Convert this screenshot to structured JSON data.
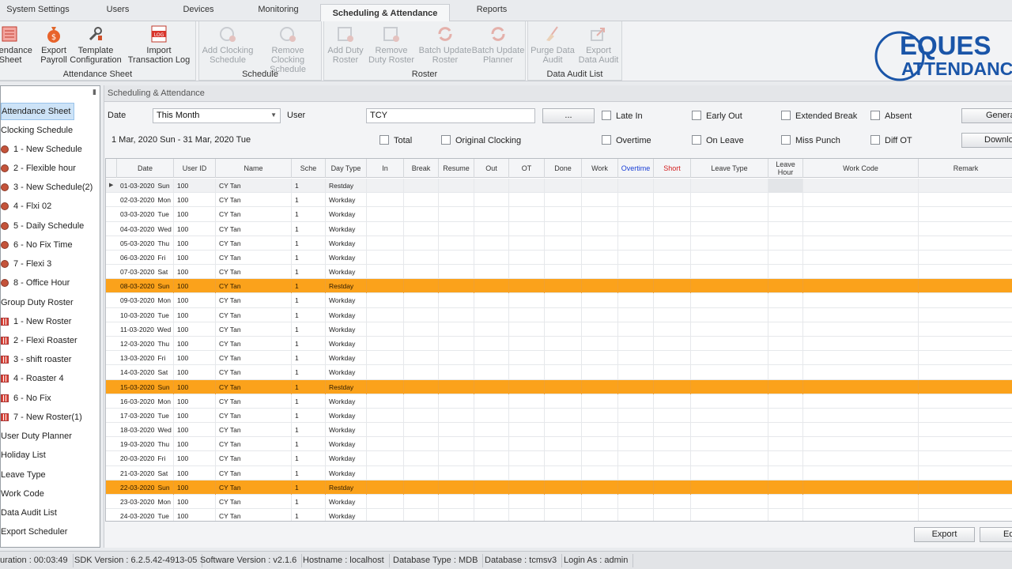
{
  "tabs": [
    {
      "label": "System Settings"
    },
    {
      "label": "Users"
    },
    {
      "label": "Devices"
    },
    {
      "label": "Monitoring"
    },
    {
      "label": "Scheduling & Attendance",
      "active": true
    },
    {
      "label": "Reports"
    }
  ],
  "ribbon": {
    "groups": [
      {
        "label": "Attendance Sheet",
        "buttons": [
          {
            "label": "Attendance Sheet",
            "icon": "sheet-icon",
            "enabled": true
          },
          {
            "label": "Export Payroll",
            "icon": "money-bag-icon",
            "enabled": true
          },
          {
            "label": "Template Configuration",
            "icon": "wrench-icon",
            "enabled": true
          },
          {
            "label": "Import Transaction Log",
            "icon": "log-icon",
            "enabled": true
          }
        ]
      },
      {
        "label": "Schedule",
        "buttons": [
          {
            "label": "Add Clocking Schedule",
            "icon": "add-schedule-icon",
            "enabled": false
          },
          {
            "label": "Remove Clocking Schedule",
            "icon": "remove-schedule-icon",
            "enabled": false
          }
        ]
      },
      {
        "label": "Roster",
        "buttons": [
          {
            "label": "Add Duty Roster",
            "icon": "add-roster-icon",
            "enabled": false
          },
          {
            "label": "Remove Duty Roster",
            "icon": "remove-roster-icon",
            "enabled": false
          },
          {
            "label": "Batch Update Roster",
            "icon": "refresh-icon",
            "enabled": false
          },
          {
            "label": "Batch Update Planner",
            "icon": "refresh-icon",
            "enabled": false
          }
        ]
      },
      {
        "label": "Data Audit List",
        "buttons": [
          {
            "label": "Purge Data Audit",
            "icon": "broom-icon",
            "enabled": false
          },
          {
            "label": "Export Data Audit",
            "icon": "export-icon",
            "enabled": false
          }
        ]
      }
    ]
  },
  "logo": {
    "line1": "EQUES",
    "line2": "ATTENDANC"
  },
  "sidebar": {
    "items": [
      {
        "label": "Attendance Sheet",
        "selected": true,
        "icon": ""
      },
      {
        "label": "Clocking Schedule",
        "icon": ""
      },
      {
        "label": "1 - New Schedule",
        "icon": "clock-icon"
      },
      {
        "label": "2 - Flexible hour",
        "icon": "clock-icon"
      },
      {
        "label": "3 - New Schedule(2)",
        "icon": "clock-icon"
      },
      {
        "label": "4 - Flxi 02",
        "icon": "clock-icon"
      },
      {
        "label": "5 - Daily Schedule",
        "icon": "clock-icon"
      },
      {
        "label": "6 - No Fix Time",
        "icon": "clock-icon"
      },
      {
        "label": "7 - Flexi 3",
        "icon": "clock-icon"
      },
      {
        "label": "8 - Office Hour",
        "icon": "clock-icon"
      },
      {
        "label": "Group Duty Roster",
        "icon": ""
      },
      {
        "label": "1 - New Roster",
        "icon": "calendar-icon"
      },
      {
        "label": "2 - Flexi Roaster",
        "icon": "calendar-icon"
      },
      {
        "label": "3 - shift roaster",
        "icon": "calendar-icon"
      },
      {
        "label": "4 - Roaster 4",
        "icon": "calendar-icon"
      },
      {
        "label": "6 - No Fix",
        "icon": "calendar-icon"
      },
      {
        "label": "7 - New Roster(1)",
        "icon": "calendar-icon"
      },
      {
        "label": "User Duty Planner",
        "icon": ""
      },
      {
        "label": "Holiday List",
        "icon": ""
      },
      {
        "label": "Leave Type",
        "icon": ""
      },
      {
        "label": "Work Code",
        "icon": ""
      },
      {
        "label": "Data Audit List",
        "icon": ""
      },
      {
        "label": "Export Scheduler",
        "icon": ""
      }
    ]
  },
  "main": {
    "title": "Scheduling & Attendance",
    "filters": {
      "date_label": "Date",
      "date_value": "This Month",
      "user_label": "User",
      "user_value": "TCY",
      "browse_label": "...",
      "range_text": "1 Mar, 2020 Sun - 31 Mar, 2020 Tue",
      "checkboxes": {
        "late_in": "Late In",
        "early_out": "Early Out",
        "extended_break": "Extended Break",
        "absent": "Absent",
        "total": "Total",
        "original_clocking": "Original Clocking",
        "overtime": "Overtime",
        "on_leave": "On Leave",
        "miss_punch": "Miss Punch",
        "diff_ot": "Diff OT"
      },
      "generate_label": "Genera",
      "download_label": "Downlo"
    },
    "grid": {
      "columns": [
        "Date",
        "User ID",
        "Name",
        "Sche",
        "Day Type",
        "In",
        "Break",
        "Resume",
        "Out",
        "OT",
        "Done",
        "Work",
        "Overtime",
        "Short",
        "Leave Type",
        "Leave Hour",
        "Work Code",
        "Remark"
      ],
      "column_colors": {
        "Overtime": "#1a3fd6",
        "Short": "#d42020"
      },
      "restday_color": "#fba21b",
      "rows": [
        {
          "date": "01-03-2020",
          "dow": "Sun",
          "user_id": "100",
          "name": "CY Tan",
          "sche": "1",
          "day_type": "Restday",
          "highlight": false,
          "current": true
        },
        {
          "date": "02-03-2020",
          "dow": "Mon",
          "user_id": "100",
          "name": "CY Tan",
          "sche": "1",
          "day_type": "Workday",
          "highlight": false
        },
        {
          "date": "03-03-2020",
          "dow": "Tue",
          "user_id": "100",
          "name": "CY Tan",
          "sche": "1",
          "day_type": "Workday",
          "highlight": false
        },
        {
          "date": "04-03-2020",
          "dow": "Wed",
          "user_id": "100",
          "name": "CY Tan",
          "sche": "1",
          "day_type": "Workday",
          "highlight": false
        },
        {
          "date": "05-03-2020",
          "dow": "Thu",
          "user_id": "100",
          "name": "CY Tan",
          "sche": "1",
          "day_type": "Workday",
          "highlight": false
        },
        {
          "date": "06-03-2020",
          "dow": "Fri",
          "user_id": "100",
          "name": "CY Tan",
          "sche": "1",
          "day_type": "Workday",
          "highlight": false
        },
        {
          "date": "07-03-2020",
          "dow": "Sat",
          "user_id": "100",
          "name": "CY Tan",
          "sche": "1",
          "day_type": "Workday",
          "highlight": false
        },
        {
          "date": "08-03-2020",
          "dow": "Sun",
          "user_id": "100",
          "name": "CY Tan",
          "sche": "1",
          "day_type": "Restday",
          "highlight": true
        },
        {
          "date": "09-03-2020",
          "dow": "Mon",
          "user_id": "100",
          "name": "CY Tan",
          "sche": "1",
          "day_type": "Workday",
          "highlight": false
        },
        {
          "date": "10-03-2020",
          "dow": "Tue",
          "user_id": "100",
          "name": "CY Tan",
          "sche": "1",
          "day_type": "Workday",
          "highlight": false
        },
        {
          "date": "11-03-2020",
          "dow": "Wed",
          "user_id": "100",
          "name": "CY Tan",
          "sche": "1",
          "day_type": "Workday",
          "highlight": false
        },
        {
          "date": "12-03-2020",
          "dow": "Thu",
          "user_id": "100",
          "name": "CY Tan",
          "sche": "1",
          "day_type": "Workday",
          "highlight": false
        },
        {
          "date": "13-03-2020",
          "dow": "Fri",
          "user_id": "100",
          "name": "CY Tan",
          "sche": "1",
          "day_type": "Workday",
          "highlight": false
        },
        {
          "date": "14-03-2020",
          "dow": "Sat",
          "user_id": "100",
          "name": "CY Tan",
          "sche": "1",
          "day_type": "Workday",
          "highlight": false
        },
        {
          "date": "15-03-2020",
          "dow": "Sun",
          "user_id": "100",
          "name": "CY Tan",
          "sche": "1",
          "day_type": "Restday",
          "highlight": true
        },
        {
          "date": "16-03-2020",
          "dow": "Mon",
          "user_id": "100",
          "name": "CY Tan",
          "sche": "1",
          "day_type": "Workday",
          "highlight": false
        },
        {
          "date": "17-03-2020",
          "dow": "Tue",
          "user_id": "100",
          "name": "CY Tan",
          "sche": "1",
          "day_type": "Workday",
          "highlight": false
        },
        {
          "date": "18-03-2020",
          "dow": "Wed",
          "user_id": "100",
          "name": "CY Tan",
          "sche": "1",
          "day_type": "Workday",
          "highlight": false
        },
        {
          "date": "19-03-2020",
          "dow": "Thu",
          "user_id": "100",
          "name": "CY Tan",
          "sche": "1",
          "day_type": "Workday",
          "highlight": false
        },
        {
          "date": "20-03-2020",
          "dow": "Fri",
          "user_id": "100",
          "name": "CY Tan",
          "sche": "1",
          "day_type": "Workday",
          "highlight": false
        },
        {
          "date": "21-03-2020",
          "dow": "Sat",
          "user_id": "100",
          "name": "CY Tan",
          "sche": "1",
          "day_type": "Workday",
          "highlight": false
        },
        {
          "date": "22-03-2020",
          "dow": "Sun",
          "user_id": "100",
          "name": "CY Tan",
          "sche": "1",
          "day_type": "Restday",
          "highlight": true
        },
        {
          "date": "23-03-2020",
          "dow": "Mon",
          "user_id": "100",
          "name": "CY Tan",
          "sche": "1",
          "day_type": "Workday",
          "highlight": false
        },
        {
          "date": "24-03-2020",
          "dow": "Tue",
          "user_id": "100",
          "name": "CY Tan",
          "sche": "1",
          "day_type": "Workday",
          "highlight": false
        }
      ]
    },
    "export_label": "Export",
    "edit_label": "Ed"
  },
  "statusbar": {
    "duration": "uration : 00:03:49",
    "sdk": "SDK Version : 6.2.5.42-4913-05",
    "software": "Software Version : v2.1.6",
    "hostname": "Hostname : localhost",
    "db_type": "Database Type : MDB",
    "database": "Database : tcmsv3",
    "login": "Login As : admin"
  }
}
